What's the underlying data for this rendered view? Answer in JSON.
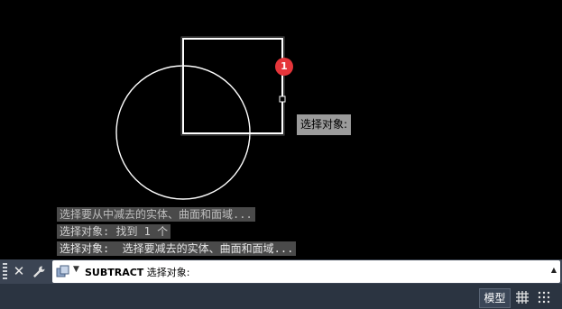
{
  "viewport": {
    "badge_number": "1",
    "tooltip_text": "选择对象:",
    "history": [
      "选择要从中减去的实体、曲面和面域...",
      "选择对象: 找到 1 个",
      "选择对象:  选择要减去的实体、曲面和面域..."
    ]
  },
  "command_line": {
    "command": "SUBTRACT",
    "prompt": " 选择对象:",
    "icons": [
      "grip-handle",
      "close-icon",
      "wrench-icon",
      "recent-commands-icon",
      "scroll-up-icon"
    ]
  },
  "status_bar": {
    "model_label": "模型",
    "icons": [
      "grid-icon",
      "snap-icon"
    ]
  },
  "colors": {
    "canvas": "#000000",
    "geometry": "#ffffff",
    "badge": "#e5353a",
    "command_bar": "#3b4453",
    "status_bar": "#2b3441"
  }
}
